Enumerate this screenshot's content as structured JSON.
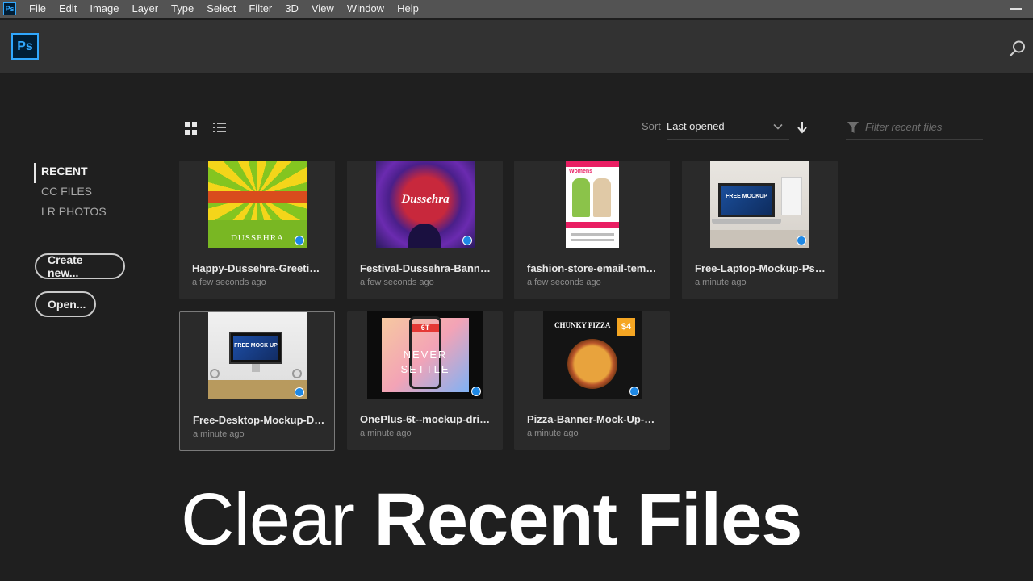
{
  "app": {
    "name": "Ps"
  },
  "menubar": [
    "File",
    "Edit",
    "Image",
    "Layer",
    "Type",
    "Select",
    "Filter",
    "3D",
    "View",
    "Window",
    "Help"
  ],
  "toolbar": {
    "sort_label": "Sort",
    "sort_value": "Last opened",
    "filter_placeholder": "Filter recent files"
  },
  "sidebar": {
    "items": [
      {
        "label": "RECENT",
        "active": true
      },
      {
        "label": "CC FILES",
        "active": false
      },
      {
        "label": "LR PHOTOS",
        "active": false
      }
    ],
    "create_label": "Create new...",
    "open_label": "Open..."
  },
  "files": [
    {
      "name": "Happy-Dussehra-Greeting...",
      "time": "a few seconds ago",
      "thumb": "dussehra-greeting"
    },
    {
      "name": "Festival-Dussehra-Banner-...",
      "time": "a few seconds ago",
      "thumb": "dussehra-banner"
    },
    {
      "name": "fashion-store-email-templ...",
      "time": "a few seconds ago",
      "thumb": "fashion-email"
    },
    {
      "name": "Free-Laptop-Mockup-Psd...",
      "time": "a minute ago",
      "thumb": "laptop-mockup"
    },
    {
      "name": "Free-Desktop-Mockup-De...",
      "time": "a minute ago",
      "thumb": "desktop-mockup"
    },
    {
      "name": "OnePlus-6t--mockup-drib...",
      "time": "a minute ago",
      "thumb": "oneplus-mockup"
    },
    {
      "name": "Pizza-Banner-Mock-Up-De...",
      "time": "a minute ago",
      "thumb": "pizza-banner"
    }
  ],
  "thumb_text": {
    "dussehra_greeting": "DUSSEHRA",
    "dussehra_banner": "Dussehra",
    "fashion": "Womens",
    "laptop": "FREE MOCKUP",
    "desktop": "FREE MOCK UP",
    "oneplus_top": "6T",
    "oneplus_mid": "NEVER",
    "oneplus_bot": "SETTLE",
    "pizza_title": "CHUNKY PIZZA",
    "pizza_price": "$4"
  },
  "caption": {
    "light": "Clear ",
    "bold": "Recent Files"
  },
  "colors": {
    "ps_blue": "#31a8ff",
    "ps_dark": "#001e36",
    "background": "#1f1f1f",
    "card": "#2a2a2a"
  }
}
